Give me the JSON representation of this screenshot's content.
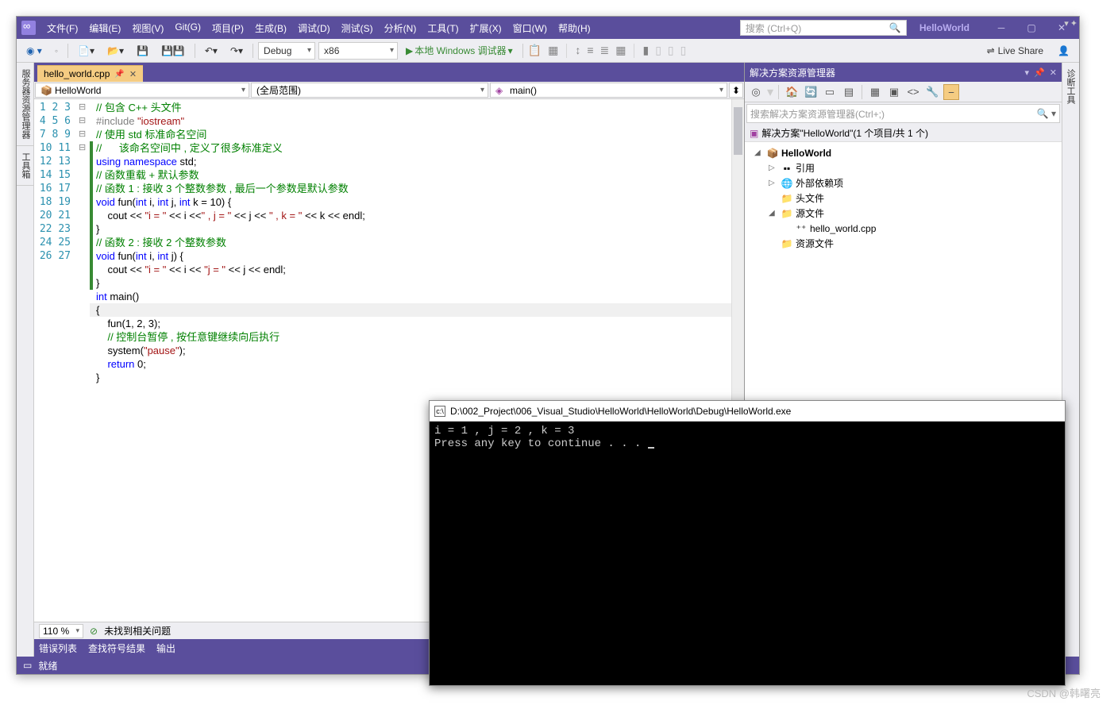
{
  "menu": [
    "文件(F)",
    "编辑(E)",
    "视图(V)",
    "Git(G)",
    "项目(P)",
    "生成(B)",
    "调试(D)",
    "测试(S)",
    "分析(N)",
    "工具(T)",
    "扩展(X)",
    "窗口(W)",
    "帮助(H)"
  ],
  "search_placeholder": "搜索 (Ctrl+Q)",
  "project_name": "HelloWorld",
  "toolbar": {
    "config": "Debug",
    "platform": "x86",
    "debug_label": "本地 Windows 调试器",
    "live_share": "Live Share"
  },
  "side_tabs_left": [
    "服务器资源管理器",
    "工具箱"
  ],
  "side_tab_right": "诊断工具",
  "file_tab": "hello_world.cpp",
  "nav": {
    "scope": "HelloWorld",
    "scope2": "(全局范围)",
    "func": "main()"
  },
  "code_lines": [
    {
      "n": 1,
      "html": "<span class='c-comment'>// 包含 C++ 头文件</span>"
    },
    {
      "n": 2,
      "html": "<span class='c-pp'>#include </span><span class='c-ppinc'>\"iostream\"</span>"
    },
    {
      "n": 3,
      "html": ""
    },
    {
      "n": 4,
      "fold": "⊟",
      "html": "<span class='c-comment'>// 使用 std 标准命名空间</span>"
    },
    {
      "n": 5,
      "bar": true,
      "html": "<span class='c-comment'>//      该命名空间中 , 定义了很多标准定义</span>"
    },
    {
      "n": 6,
      "bar": true,
      "html": "<span class='c-keyword'>using namespace</span> std;"
    },
    {
      "n": 7,
      "html": ""
    },
    {
      "n": 8,
      "bar": true,
      "html": "<span class='c-comment'>// 函数重载 + 默认参数</span>"
    },
    {
      "n": 9,
      "html": ""
    },
    {
      "n": 10,
      "bar": true,
      "html": "<span class='c-comment'>// 函数 1 : 接收 3 个整数参数 , 最后一个参数是默认参数</span>"
    },
    {
      "n": 11,
      "fold": "⊟",
      "bar": true,
      "html": "<span class='c-keyword'>void</span> fun(<span class='c-keyword'>int</span> i, <span class='c-keyword'>int</span> j, <span class='c-keyword'>int</span> k = 10) {"
    },
    {
      "n": 12,
      "bar": true,
      "html": "    cout &lt;&lt; <span class='c-string'>\"i = \"</span> &lt;&lt; i &lt;&lt;<span class='c-string'>\" , j = \"</span> &lt;&lt; j &lt;&lt; <span class='c-string'>\" , k = \"</span> &lt;&lt; k &lt;&lt; endl;"
    },
    {
      "n": 13,
      "bar": true,
      "html": "}"
    },
    {
      "n": 14,
      "html": ""
    },
    {
      "n": 15,
      "bar": true,
      "html": "<span class='c-comment'>// 函数 2 : 接收 2 个整数参数</span>"
    },
    {
      "n": 16,
      "fold": "⊟",
      "bar": true,
      "html": "<span class='c-keyword'>void</span> fun(<span class='c-keyword'>int</span> i, <span class='c-keyword'>int</span> j) {"
    },
    {
      "n": 17,
      "bar": true,
      "html": "    cout &lt;&lt; <span class='c-string'>\"i = \"</span> &lt;&lt; i &lt;&lt; <span class='c-string'>\"j = \"</span> &lt;&lt; j &lt;&lt; endl;"
    },
    {
      "n": 18,
      "bar": true,
      "html": "}"
    },
    {
      "n": 19,
      "html": ""
    },
    {
      "n": 20,
      "fold": "⊟",
      "html": "<span class='c-keyword'>int</span> main()"
    },
    {
      "n": 21,
      "html": "{",
      "hl": true
    },
    {
      "n": 22,
      "html": "    fun(1, 2, 3);"
    },
    {
      "n": 23,
      "html": ""
    },
    {
      "n": 24,
      "html": "    <span class='c-comment'>// 控制台暂停 , 按任意键继续向后执行</span>"
    },
    {
      "n": 25,
      "html": "    system(<span class='c-string'>\"pause\"</span>);"
    },
    {
      "n": 26,
      "html": "    <span class='c-keyword'>return</span> 0;"
    },
    {
      "n": 27,
      "html": "}"
    }
  ],
  "zoom": "110 %",
  "issues": "未找到相关问题",
  "bottom_tabs": [
    "错误列表",
    "查找符号结果",
    "输出"
  ],
  "status": "就绪",
  "explorer": {
    "title": "解决方案资源管理器",
    "search": "搜索解决方案资源管理器(Ctrl+;)",
    "solution": "解决方案\"HelloWorld\"(1 个项目/共 1 个)",
    "tree": [
      {
        "indent": 0,
        "arrow": "◢",
        "icon": "📦",
        "label": "HelloWorld",
        "bold": true
      },
      {
        "indent": 1,
        "arrow": "▷",
        "icon": "▪▪",
        "label": "引用"
      },
      {
        "indent": 1,
        "arrow": "▷",
        "icon": "🌐",
        "label": "外部依赖项"
      },
      {
        "indent": 1,
        "arrow": "",
        "icon": "📁",
        "label": "头文件"
      },
      {
        "indent": 1,
        "arrow": "◢",
        "icon": "📁",
        "label": "源文件"
      },
      {
        "indent": 2,
        "arrow": "",
        "icon": "⁺⁺",
        "label": "hello_world.cpp"
      },
      {
        "indent": 1,
        "arrow": "",
        "icon": "📁",
        "label": "资源文件"
      }
    ]
  },
  "console": {
    "title": "D:\\002_Project\\006_Visual_Studio\\HelloWorld\\HelloWorld\\Debug\\HelloWorld.exe",
    "lines": [
      "i = 1 , j = 2 , k = 3",
      "Press any key to continue . . . "
    ]
  },
  "watermark": "CSDN @韩曙亮"
}
